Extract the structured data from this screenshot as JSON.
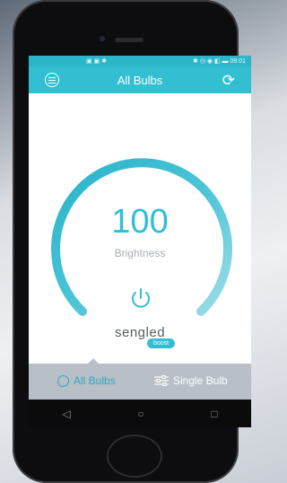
{
  "status_bar": {
    "left_icons": "▣ ▣ ✱",
    "right_icons": "✱ ◷ ◉ ◧ ▬",
    "time": "09:01"
  },
  "app_bar": {
    "title": "All Bulbs",
    "left_icon": "menu-icon",
    "right_icon": "sync-icon"
  },
  "brightness": {
    "value": "100",
    "label": "Brightness",
    "level_fraction": 1.0
  },
  "logo": {
    "word": "sengled",
    "badge": "boost"
  },
  "bottom_tabs": [
    {
      "label": "All Bulbs",
      "active": true
    },
    {
      "label": "Single Bulb",
      "active": false
    }
  ],
  "nav_bar": {
    "back": "◁",
    "home": "○",
    "recents": "□"
  },
  "colors": {
    "accent": "#33bfd2",
    "bottom_bar": "#b8bfc6"
  }
}
